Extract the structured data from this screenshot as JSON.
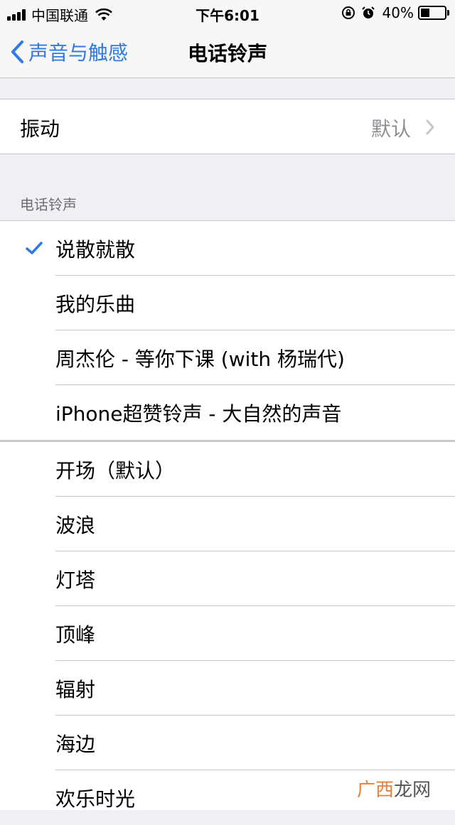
{
  "status_bar": {
    "carrier": "中国联通",
    "time": "下午6:01",
    "battery_percent": "40%",
    "battery_level": 0.4
  },
  "nav": {
    "back_label": "声音与触感",
    "title": "电话铃声"
  },
  "vibration": {
    "label": "振动",
    "value": "默认"
  },
  "section_header": "电话铃声",
  "custom_tones": [
    {
      "label": "说散就散",
      "selected": true
    },
    {
      "label": "我的乐曲",
      "selected": false
    },
    {
      "label": "周杰伦 - 等你下课 (with 杨瑞代)",
      "selected": false
    },
    {
      "label": "iPhone超赞铃声 - 大自然的声音",
      "selected": false
    }
  ],
  "default_tones": [
    {
      "label": "开场（默认）"
    },
    {
      "label": "波浪"
    },
    {
      "label": "灯塔"
    },
    {
      "label": "顶峰"
    },
    {
      "label": "辐射"
    },
    {
      "label": "海边"
    },
    {
      "label": "欢乐时光"
    }
  ],
  "watermark": {
    "part1": "广西",
    "part2": "龙网"
  },
  "colors": {
    "accent": "#2f7ae5",
    "background": "#efeff4",
    "separator": "#c8c7cc"
  }
}
